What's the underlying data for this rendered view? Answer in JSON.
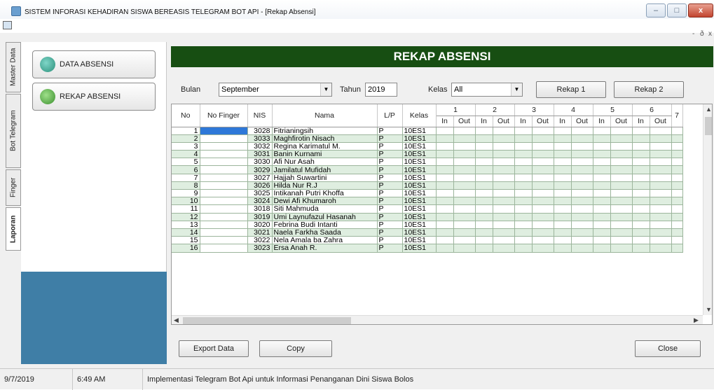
{
  "window": {
    "title": "SISTEM INFORASI KEHADIRAN SISWA BEREASIS TELEGRAM BOT API - [Rekap Absensi]",
    "min_label": "–",
    "max_label": "□",
    "close_label": "x",
    "mdi_min": "-",
    "mdi_restore": "ð",
    "mdi_close": "x"
  },
  "side_tabs": [
    "Master Data",
    "Bot Telegram",
    "Finger",
    "Laporan"
  ],
  "nav": {
    "data_absensi": "DATA ABSENSI",
    "rekap_absensi": "REKAP ABSENSI"
  },
  "header": {
    "title": "REKAP ABSENSI"
  },
  "filters": {
    "bulan_label": "Bulan",
    "bulan_value": "September",
    "tahun_label": "Tahun",
    "tahun_value": "2019",
    "kelas_label": "Kelas",
    "kelas_value": "All",
    "rekap1": "Rekap 1",
    "rekap2": "Rekap 2"
  },
  "grid": {
    "columns": [
      "No",
      "No Finger",
      "NIS",
      "Nama",
      "L/P",
      "Kelas"
    ],
    "days": [
      "1",
      "2",
      "3",
      "4",
      "5",
      "6",
      "7"
    ],
    "in_label": "In",
    "out_label": "Out",
    "rows": [
      {
        "no": "1",
        "nis": "3028",
        "nama": "Fitrianingsih",
        "lp": "P",
        "kelas": "10ES1"
      },
      {
        "no": "2",
        "nis": "3033",
        "nama": "Maghfirotin Nisach",
        "lp": "P",
        "kelas": "10ES1"
      },
      {
        "no": "3",
        "nis": "3032",
        "nama": "Regina Karimatul M.",
        "lp": "P",
        "kelas": "10ES1"
      },
      {
        "no": "4",
        "nis": "3031",
        "nama": "Banin Kurnami",
        "lp": "P",
        "kelas": "10ES1"
      },
      {
        "no": "5",
        "nis": "3030",
        "nama": "Afi Nur Asah",
        "lp": "P",
        "kelas": "10ES1"
      },
      {
        "no": "6",
        "nis": "3029",
        "nama": "Jamilatul Mufidah",
        "lp": "P",
        "kelas": "10ES1"
      },
      {
        "no": "7",
        "nis": "3027",
        "nama": "Hajjah Suwartini",
        "lp": "P",
        "kelas": "10ES1"
      },
      {
        "no": "8",
        "nis": "3026",
        "nama": "Hilda Nur R.J",
        "lp": "P",
        "kelas": "10ES1"
      },
      {
        "no": "9",
        "nis": "3025",
        "nama": "Intikanah Putri Khoffa",
        "lp": "P",
        "kelas": "10ES1"
      },
      {
        "no": "10",
        "nis": "3024",
        "nama": "Dewi Afi Khumaroh",
        "lp": "P",
        "kelas": "10ES1"
      },
      {
        "no": "11",
        "nis": "3018",
        "nama": "Siti Mahmuda",
        "lp": "P",
        "kelas": "10ES1"
      },
      {
        "no": "12",
        "nis": "3019",
        "nama": "Umi Laynufazul Hasanah",
        "lp": "P",
        "kelas": "10ES1"
      },
      {
        "no": "13",
        "nis": "3020",
        "nama": "Febrina Budi Intanti",
        "lp": "P",
        "kelas": "10ES1"
      },
      {
        "no": "14",
        "nis": "3021",
        "nama": "Naela Farkha Saada",
        "lp": "P",
        "kelas": "10ES1"
      },
      {
        "no": "15",
        "nis": "3022",
        "nama": "Nela Amala ba Zahra",
        "lp": "P",
        "kelas": "10ES1"
      },
      {
        "no": "16",
        "nis": "3023",
        "nama": "Ersa Anah R.",
        "lp": "P",
        "kelas": "10ES1"
      }
    ]
  },
  "bottom": {
    "export": "Export Data",
    "copy": "Copy",
    "close": "Close"
  },
  "statusbar": {
    "date": "9/7/2019",
    "time": "6:49 AM",
    "message": "Implementasi Telegram Bot Api untuk Informasi Penanganan Dini Siswa Bolos"
  },
  "colors": {
    "header_green": "#174e12",
    "row_alt": "#dfeee0",
    "selected_cell": "#2e78d8",
    "left_panel_blue": "#3f7ea6"
  }
}
